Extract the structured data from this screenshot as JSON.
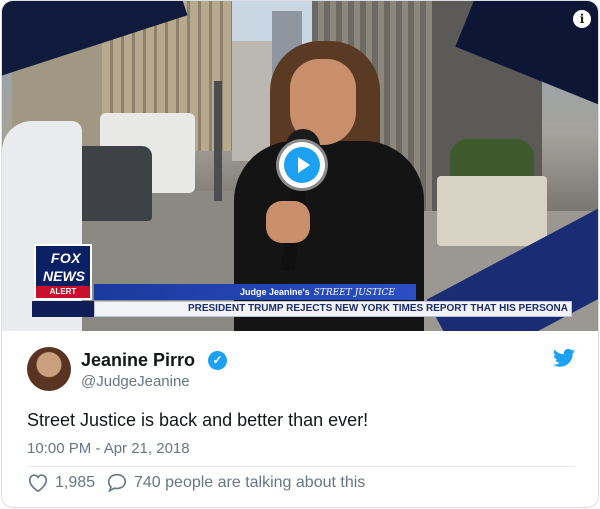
{
  "video": {
    "info_icon": "info-icon",
    "play_icon": "play-icon",
    "lower_third": {
      "network_top": "FOX",
      "network_bottom": "NEWS",
      "alert_label": "ALERT",
      "show_label": "Judge Jeanine's",
      "show_script": "STREET JUSTICE",
      "ticker": "PRESIDENT TRUMP REJECTS NEW YORK TIMES REPORT THAT HIS PERSONA"
    }
  },
  "tweet": {
    "author_name": "Jeanine Pirro",
    "verified_icon": "verified-badge-icon",
    "handle": "@JudgeJeanine",
    "brand_icon": "twitter-bird-icon",
    "text": "Street Justice is back and better than ever!",
    "timestamp": "10:00 PM - Apr 21, 2018",
    "likes": "1,985",
    "talking": "740 people are talking about this"
  },
  "colors": {
    "twitter_blue": "#1da1f2",
    "secondary_text": "#657786",
    "fox_blue": "#0b1f63"
  }
}
